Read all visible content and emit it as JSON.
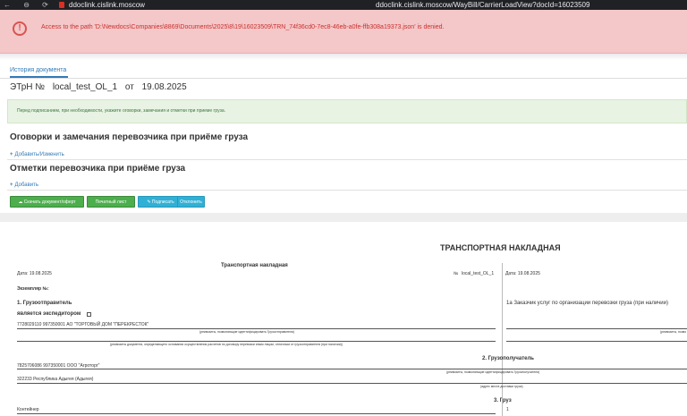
{
  "browser": {
    "nav_icons": "← ⊖ ⟳",
    "url_left": "ddoclink.cislink.moscow",
    "url_right": "ddoclink.cislink.moscow/WayBill/CarrierLoadView?docId=16023509"
  },
  "alert": {
    "icon": "!",
    "message": "Access to the path 'D:\\Newdocs\\Companies\\8869\\Documents\\2025\\8\\19\\16023509\\TRN_74f36cd0-7ec8-46eb-a0fe-ffb308a19373.json' is denied."
  },
  "tabs": {
    "history": "История документа"
  },
  "document": {
    "type": "ЭТрН №",
    "number": "local_test_OL_1",
    "from": "от",
    "date": "19.08.2025"
  },
  "info": "Перед подписанием, при необходимости, укажите оговорки, замечания и отметки при приеме груза.",
  "sections": {
    "remarks_title": "Оговорки и замечания перевозчика при приёме груза",
    "remarks_link": "Добавить/Изменить",
    "marks_title": "Отметки перевозчика при приёме груза",
    "marks_link": "Добавить",
    "plus": "+"
  },
  "buttons": {
    "download": "Скачать документ/оферт",
    "print": "Печатный лист",
    "sign": "Подписать",
    "refuse": "Отклонить"
  },
  "waybill": {
    "big_title": "ТРАНСПОРТНАЯ НАКЛАДНАЯ",
    "sub_title": "Транспортная накладная",
    "date_left": "Дата: 19.08.2025",
    "number_label": "№",
    "number_value": "local_test_OL_1",
    "date_right": "Дата: 19.08.2025",
    "copy_label": "Экземпляр №:",
    "sender_title": "1. Грузоотправитель",
    "forwarder_label": "является экспедитором",
    "sender_value": "7728029110 997350001 АО \"ТОРГОВЫЙ ДОМ \"ПЕРЕКРЕСТОК\"",
    "hint_requisites": "(реквизиты, позволяющие идентифицировать Грузоотправителя)",
    "hint_document": "(реквизиты документа, определяющего основания осуществления расчетов по договору перевозки иным лицом, отличным от грузоотправителя (при наличии))",
    "customer_title": "1а Заказчик услуг по организации перевозки груза (при наличии)",
    "hint_customer": "(реквизиты, позво",
    "receiver_title": "2. Грузополучатель",
    "receiver_value": "7825706086 997350001 ООО \"Агроторг\"",
    "hint_receiver": "(реквизиты, позволяющие идентифицировать Грузополучателя)",
    "address_value": "322233 Республика Адыгея (Адыгея)",
    "hint_address": "(адрес места доставки груза)",
    "cargo_title": "3. Груз",
    "container_label": "Контейнер",
    "cargo_num": "1"
  }
}
